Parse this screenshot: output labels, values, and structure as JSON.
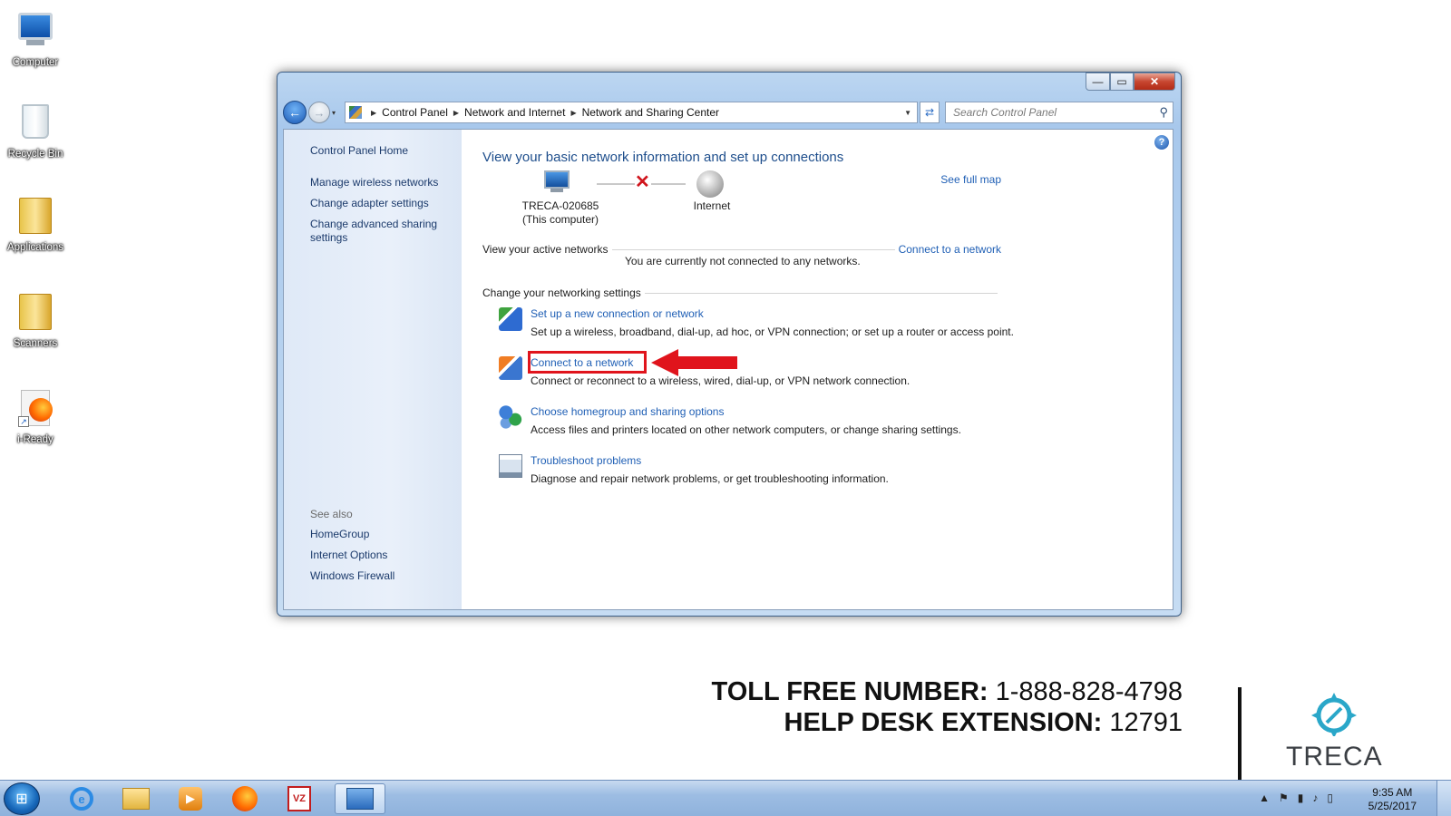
{
  "desktop": {
    "icons": [
      {
        "label": "Computer",
        "icon": "computer-icon"
      },
      {
        "label": "Recycle Bin",
        "icon": "recycle-bin-icon"
      },
      {
        "label": "Applications",
        "icon": "folder-icon"
      },
      {
        "label": "Scanners",
        "icon": "folder-icon"
      },
      {
        "label": "i-Ready",
        "icon": "firefox-shortcut-icon"
      }
    ]
  },
  "window": {
    "controls": {
      "minimize": "—",
      "maximize": "▭",
      "close": "✕"
    },
    "nav": {
      "back": "←",
      "forward": "→",
      "dropdown": "▾"
    },
    "breadcrumbs": [
      "Control Panel",
      "Network and Internet",
      "Network and Sharing Center"
    ],
    "search_placeholder": "Search Control Panel",
    "sidebar": {
      "home": "Control Panel Home",
      "tasks": [
        "Manage wireless networks",
        "Change adapter settings",
        "Change advanced sharing settings"
      ],
      "see_also_heading": "See also",
      "see_also": [
        "HomeGroup",
        "Internet Options",
        "Windows Firewall"
      ]
    },
    "main": {
      "title": "View your basic network information and set up connections",
      "see_full_map": "See full map",
      "computer_name": "TRECA-020685",
      "computer_sub": "(This computer)",
      "internet_label": "Internet",
      "active_networks_heading": "View your active networks",
      "connect_link": "Connect to a network",
      "not_connected": "You are currently not connected to any networks.",
      "change_settings_heading": "Change your networking settings",
      "tasks": [
        {
          "link": "Set up a new connection or network",
          "desc": "Set up a wireless, broadband, dial-up, ad hoc, or VPN connection; or set up a router or access point."
        },
        {
          "link": "Connect to a network",
          "desc": "Connect or reconnect to a wireless, wired, dial-up, or VPN network connection."
        },
        {
          "link": "Choose homegroup and sharing options",
          "desc": "Access files and printers located on other network computers, or change sharing settings."
        },
        {
          "link": "Troubleshoot problems",
          "desc": "Diagnose and repair network problems, or get troubleshooting information."
        }
      ]
    }
  },
  "banner": {
    "toll_free_label": "TOLL FREE NUMBER:",
    "toll_free_number": "1-888-828-4798",
    "help_desk_label": "HELP DESK EXTENSION:",
    "help_desk_ext": "12791",
    "brand": "TRECA"
  },
  "taskbar": {
    "time": "9:35 AM",
    "date": "5/25/2017"
  },
  "colors": {
    "link": "#1f5fb5",
    "highlight": "#e0141c",
    "title": "#1e4e8c"
  }
}
